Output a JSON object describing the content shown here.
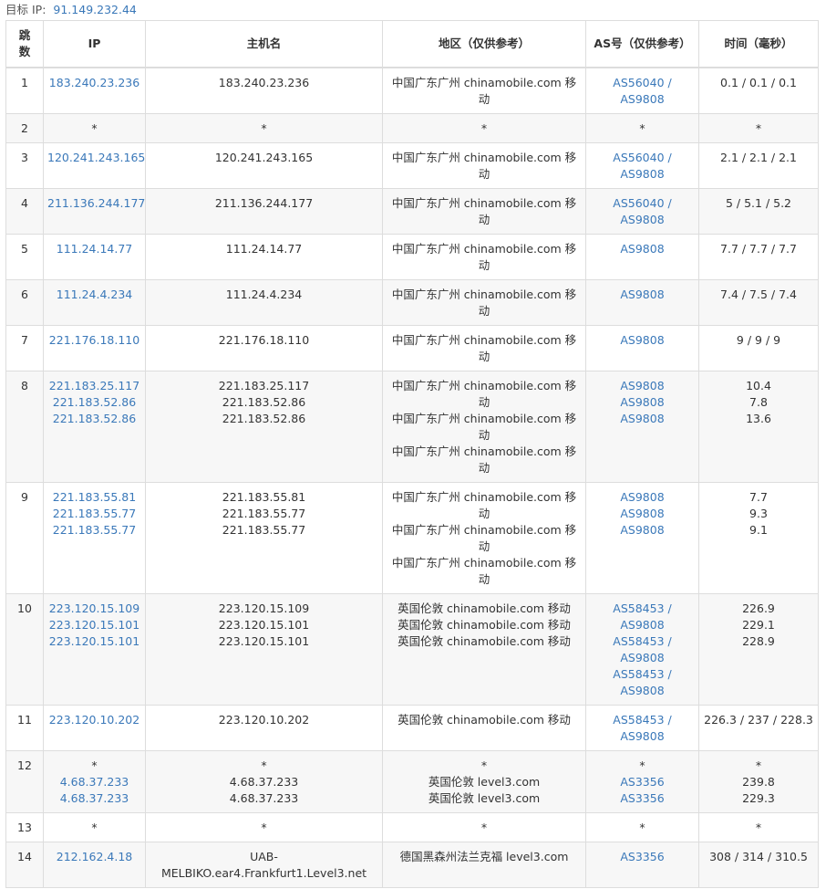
{
  "target": {
    "label": "目标 IP:",
    "ip": "91.149.232.44"
  },
  "headers": {
    "hop": "跳数",
    "ip": "IP",
    "host": "主机名",
    "region": "地区（仅供参考）",
    "as": "AS号（仅供参考）",
    "time": "时间（毫秒）"
  },
  "rows": [
    {
      "hop": "1",
      "ips": [
        "183.240.23.236"
      ],
      "hosts": [
        "183.240.23.236"
      ],
      "regions": [
        "中国广东广州 chinamobile.com 移动"
      ],
      "as": [
        "AS56040 / AS9808"
      ],
      "times": [
        "0.1 / 0.1 / 0.1"
      ]
    },
    {
      "hop": "2",
      "ips": [
        "*"
      ],
      "hosts": [
        "*"
      ],
      "regions": [
        "*"
      ],
      "as": [
        "*"
      ],
      "times": [
        "*"
      ]
    },
    {
      "hop": "3",
      "ips": [
        "120.241.243.165"
      ],
      "hosts": [
        "120.241.243.165"
      ],
      "regions": [
        "中国广东广州 chinamobile.com 移动"
      ],
      "as": [
        "AS56040 / AS9808"
      ],
      "times": [
        "2.1 / 2.1 / 2.1"
      ]
    },
    {
      "hop": "4",
      "ips": [
        "211.136.244.177"
      ],
      "hosts": [
        "211.136.244.177"
      ],
      "regions": [
        "中国广东广州 chinamobile.com 移动"
      ],
      "as": [
        "AS56040 / AS9808"
      ],
      "times": [
        "5 / 5.1 / 5.2"
      ]
    },
    {
      "hop": "5",
      "ips": [
        "111.24.14.77"
      ],
      "hosts": [
        "111.24.14.77"
      ],
      "regions": [
        "中国广东广州 chinamobile.com 移动"
      ],
      "as": [
        "AS9808"
      ],
      "times": [
        "7.7 / 7.7 / 7.7"
      ]
    },
    {
      "hop": "6",
      "ips": [
        "111.24.4.234"
      ],
      "hosts": [
        "111.24.4.234"
      ],
      "regions": [
        "中国广东广州 chinamobile.com 移动"
      ],
      "as": [
        "AS9808"
      ],
      "times": [
        "7.4 / 7.5 / 7.4"
      ]
    },
    {
      "hop": "7",
      "ips": [
        "221.176.18.110"
      ],
      "hosts": [
        "221.176.18.110"
      ],
      "regions": [
        "中国广东广州 chinamobile.com 移动"
      ],
      "as": [
        "AS9808"
      ],
      "times": [
        "9 / 9 / 9"
      ]
    },
    {
      "hop": "8",
      "ips": [
        "221.183.25.117",
        "221.183.52.86",
        "221.183.52.86"
      ],
      "hosts": [
        "221.183.25.117",
        "221.183.52.86",
        "221.183.52.86"
      ],
      "regions": [
        "中国广东广州 chinamobile.com 移动",
        "中国广东广州 chinamobile.com 移动",
        "中国广东广州 chinamobile.com 移动"
      ],
      "as": [
        "AS9808",
        "AS9808",
        "AS9808"
      ],
      "times": [
        "10.4",
        "7.8",
        "13.6"
      ]
    },
    {
      "hop": "9",
      "ips": [
        "221.183.55.81",
        "221.183.55.77",
        "221.183.55.77"
      ],
      "hosts": [
        "221.183.55.81",
        "221.183.55.77",
        "221.183.55.77"
      ],
      "regions": [
        "中国广东广州 chinamobile.com 移动",
        "中国广东广州 chinamobile.com 移动",
        "中国广东广州 chinamobile.com 移动"
      ],
      "as": [
        "AS9808",
        "AS9808",
        "AS9808"
      ],
      "times": [
        "7.7",
        "9.3",
        "9.1"
      ]
    },
    {
      "hop": "10",
      "ips": [
        "223.120.15.109",
        "223.120.15.101",
        "223.120.15.101"
      ],
      "hosts": [
        "223.120.15.109",
        "223.120.15.101",
        "223.120.15.101"
      ],
      "regions": [
        "英国伦敦 chinamobile.com 移动",
        "英国伦敦 chinamobile.com 移动",
        "英国伦敦 chinamobile.com 移动"
      ],
      "as": [
        "AS58453 / AS9808",
        "AS58453 / AS9808",
        "AS58453 / AS9808"
      ],
      "times": [
        "226.9",
        "229.1",
        "228.9"
      ]
    },
    {
      "hop": "11",
      "ips": [
        "223.120.10.202"
      ],
      "hosts": [
        "223.120.10.202"
      ],
      "regions": [
        "英国伦敦 chinamobile.com 移动"
      ],
      "as": [
        "AS58453 / AS9808"
      ],
      "times": [
        "226.3 / 237 / 228.3"
      ]
    },
    {
      "hop": "12",
      "ips": [
        "*",
        "4.68.37.233",
        "4.68.37.233"
      ],
      "hosts": [
        "*",
        "4.68.37.233",
        "4.68.37.233"
      ],
      "regions": [
        "*",
        "英国伦敦 level3.com",
        "英国伦敦 level3.com"
      ],
      "as": [
        "*",
        "AS3356",
        "AS3356"
      ],
      "times": [
        "*",
        "239.8",
        "229.3"
      ]
    },
    {
      "hop": "13",
      "ips": [
        "*"
      ],
      "hosts": [
        "*"
      ],
      "regions": [
        "*"
      ],
      "as": [
        "*"
      ],
      "times": [
        "*"
      ]
    },
    {
      "hop": "14",
      "ips": [
        "212.162.4.18"
      ],
      "hosts": [
        "UAB-MELBIKO.ear4.Frankfurt1.Level3.net"
      ],
      "regions": [
        "德国黑森州法兰克福 level3.com"
      ],
      "as": [
        "AS3356"
      ],
      "times": [
        "308 / 314 / 310.5"
      ]
    }
  ]
}
